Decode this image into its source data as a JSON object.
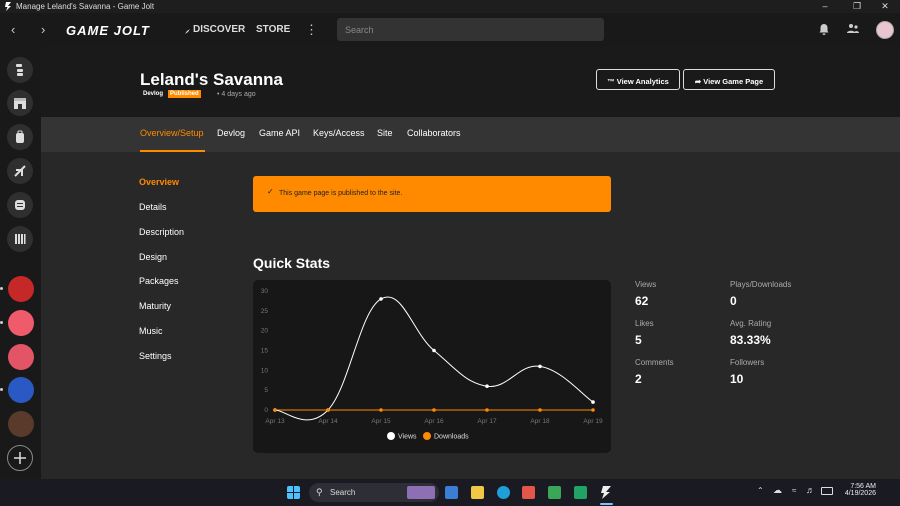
{
  "window": {
    "title": "Manage Leland's Savanna - Game Jolt"
  },
  "nav": {
    "logo": "GAME JOLT",
    "discover": "DISCOVER",
    "store": "STORE",
    "search_placeholder": "Search"
  },
  "game": {
    "title": "Leland's Savanna",
    "type_tag": "Devlog",
    "status_tag": "Published",
    "updated": "4 days ago",
    "view_analytics": "View Analytics",
    "view_game_page": "View Game Page"
  },
  "tabs": [
    "Overview/Setup",
    "Devlog",
    "Game API",
    "Keys/Access",
    "Site",
    "Collaborators"
  ],
  "sidenav": [
    "Overview",
    "Details",
    "Description",
    "Design",
    "Packages",
    "Maturity",
    "Music",
    "Settings"
  ],
  "alert": {
    "message": "This game page is published to the site."
  },
  "quick_stats": {
    "title": "Quick Stats",
    "stats": [
      {
        "label": "Views",
        "value": "62"
      },
      {
        "label": "Plays/Downloads",
        "value": "0"
      },
      {
        "label": "Likes",
        "value": "5"
      },
      {
        "label": "Avg. Rating",
        "value": "83.33%"
      },
      {
        "label": "Comments",
        "value": "2"
      },
      {
        "label": "Followers",
        "value": "10"
      }
    ]
  },
  "chart_data": {
    "type": "line",
    "categories": [
      "Apr 13",
      "Apr 14",
      "Apr 15",
      "Apr 16",
      "Apr 17",
      "Apr 18",
      "Apr 19"
    ],
    "yticks": [
      "0",
      "5",
      "10",
      "15",
      "20",
      "25",
      "30"
    ],
    "ylim": [
      0,
      30
    ],
    "grid": false,
    "legend": "bottom",
    "series": [
      {
        "name": "Views",
        "color": "#ffffff",
        "values": [
          0,
          0,
          28,
          15,
          6,
          11,
          2
        ]
      },
      {
        "name": "Downloads",
        "color": "#ff8a00",
        "values": [
          0,
          0,
          0,
          0,
          0,
          0,
          0
        ]
      }
    ]
  },
  "taskbar": {
    "search": "Search",
    "time": "7:56 AM",
    "date": "4/19/2026"
  },
  "colors": {
    "accent": "#ff8a00",
    "background": "#292829"
  }
}
